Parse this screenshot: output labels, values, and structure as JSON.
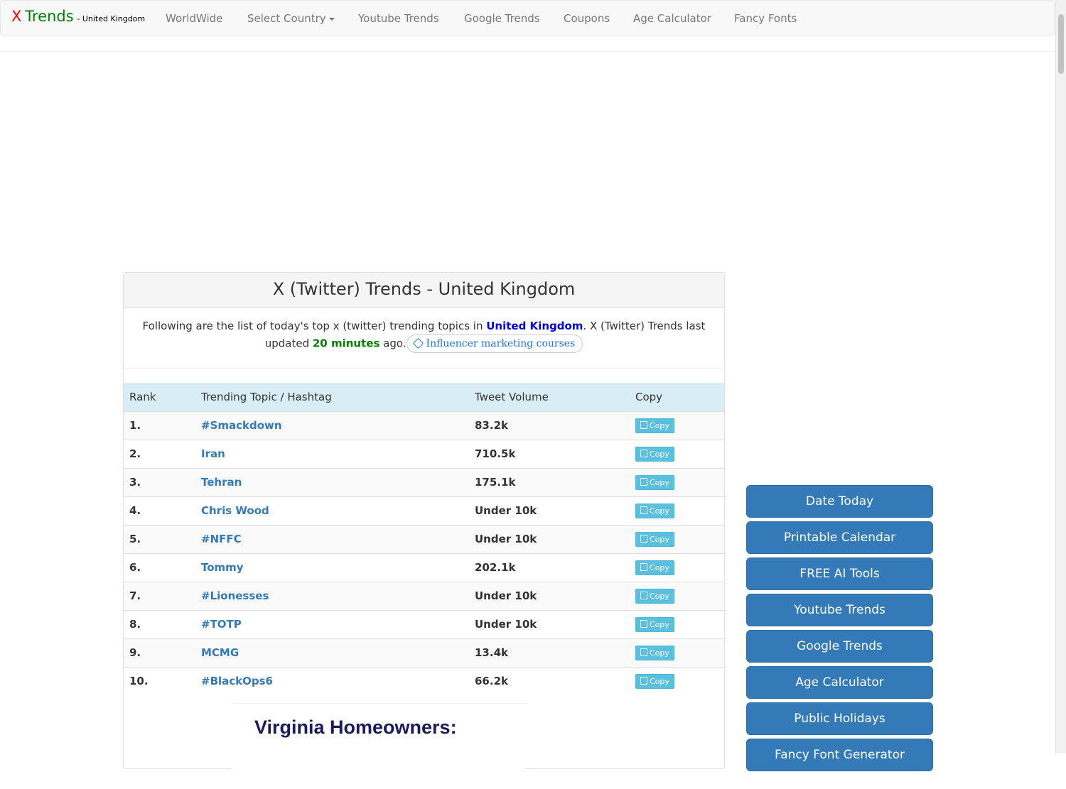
{
  "navbar": {
    "brand_x": "X",
    "brand_trends": "Trends",
    "brand_sub": "- United Kingdom",
    "items": [
      "WorldWide",
      "Select Country",
      "Youtube Trends",
      "Google Trends",
      "Coupons",
      "Age Calculator",
      "Fancy Fonts"
    ]
  },
  "panel": {
    "title": "X (Twitter) Trends - United Kingdom",
    "intro_before": "Following are the list of today's top x (twitter) trending topics in ",
    "intro_country": "United Kingdom",
    "intro_middle": ". X (Twitter) Trends last updated ",
    "intro_updated": "20 minutes",
    "intro_after": " ago.",
    "tag_link": "Influencer marketing courses"
  },
  "table": {
    "headers": [
      "Rank",
      "Trending Topic / Hashtag",
      "Tweet Volume",
      "Copy"
    ],
    "rows": [
      {
        "rank": "1.",
        "topic": "#Smackdown",
        "volume": "83.2k",
        "copy": "Copy"
      },
      {
        "rank": "2.",
        "topic": "Iran",
        "volume": "710.5k",
        "copy": "Copy"
      },
      {
        "rank": "3.",
        "topic": "Tehran",
        "volume": "175.1k",
        "copy": "Copy"
      },
      {
        "rank": "4.",
        "topic": "Chris Wood",
        "volume": "Under 10k",
        "copy": "Copy"
      },
      {
        "rank": "5.",
        "topic": "#NFFC",
        "volume": "Under 10k",
        "copy": "Copy"
      },
      {
        "rank": "6.",
        "topic": "Tommy",
        "volume": "202.1k",
        "copy": "Copy"
      },
      {
        "rank": "7.",
        "topic": "#Lionesses",
        "volume": "Under 10k",
        "copy": "Copy"
      },
      {
        "rank": "8.",
        "topic": "#TOTP",
        "volume": "Under 10k",
        "copy": "Copy"
      },
      {
        "rank": "9.",
        "topic": "MCMG",
        "volume": "13.4k",
        "copy": "Copy"
      },
      {
        "rank": "10.",
        "topic": "#BlackOps6",
        "volume": "66.2k",
        "copy": "Copy"
      }
    ]
  },
  "ad": {
    "headline": "Virginia Homeowners:"
  },
  "sidebar": {
    "buttons": [
      "Date Today",
      "Printable Calendar",
      "FREE AI Tools",
      "Youtube Trends",
      "Google Trends",
      "Age Calculator",
      "Public Holidays",
      "Fancy Font Generator"
    ]
  },
  "colors": {
    "brand_x": "#ff0000",
    "brand_trends": "#008000",
    "link": "#337ab7",
    "country_link": "#0000ee",
    "updated": "#008000",
    "table_header_bg": "#d9edf7",
    "copy_button": "#5bc0de",
    "sidebar_button": "#337ab7"
  },
  "icons": [
    "caret-down-icon",
    "tag-icon",
    "copy-icon"
  ]
}
